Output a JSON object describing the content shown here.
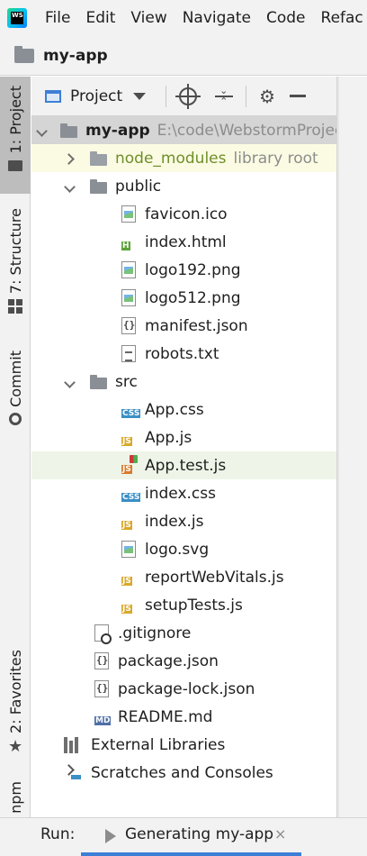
{
  "menubar": {
    "logo_text": "WS",
    "items": [
      "File",
      "Edit",
      "View",
      "Navigate",
      "Code",
      "Refac"
    ]
  },
  "navbar": {
    "project_name": "my-app"
  },
  "left_strip": {
    "project": "1: Project",
    "structure": "7: Structure",
    "commit": "Commit",
    "favorites": "2: Favorites",
    "npm": "npm"
  },
  "project_toolbar": {
    "view_label": "Project"
  },
  "tree": {
    "root": {
      "name": "my-app",
      "path": "E:\\code\\WebstormProjec"
    },
    "node_modules": {
      "name": "node_modules",
      "hint": "library root"
    },
    "public": {
      "name": "public",
      "files": [
        "favicon.ico",
        "index.html",
        "logo192.png",
        "logo512.png",
        "manifest.json",
        "robots.txt"
      ]
    },
    "src": {
      "name": "src",
      "files": [
        "App.css",
        "App.js",
        "App.test.js",
        "index.css",
        "index.js",
        "logo.svg",
        "reportWebVitals.js",
        "setupTests.js"
      ]
    },
    "root_files": [
      ".gitignore",
      "package.json",
      "package-lock.json",
      "README.md"
    ],
    "external_libraries": "External Libraries",
    "scratches": "Scratches and Consoles"
  },
  "runbar": {
    "label": "Run:",
    "tab_label": "Generating my-app",
    "close_glyph": "×"
  },
  "icons": {
    "badge_css": "CSS",
    "badge_js": "JS",
    "badge_html": "H",
    "badge_md": "MD"
  },
  "colors": {
    "accent": "#3d7fd6",
    "library_root_text": "#6f8f2a",
    "selected_row": "#d5d5d5",
    "node_modules_row": "#fbfbe3",
    "test_row": "#eef5e8"
  }
}
